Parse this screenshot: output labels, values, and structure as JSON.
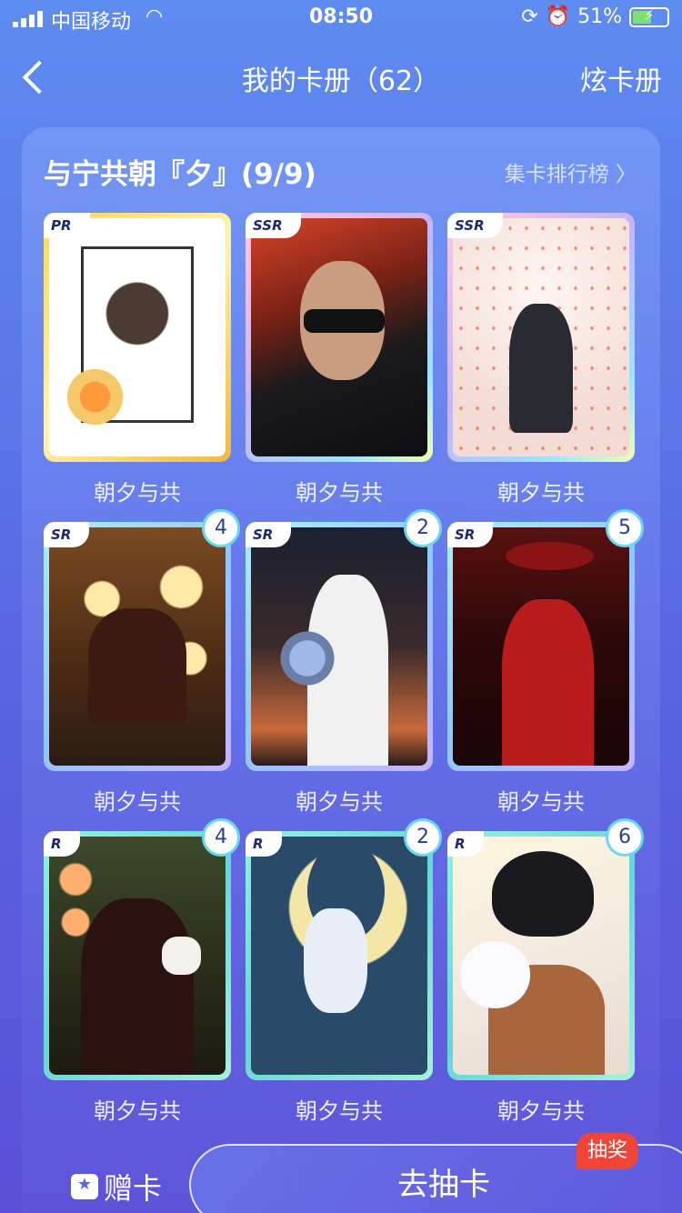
{
  "status_bar": {
    "carrier": "中国移动",
    "time": "08:50",
    "battery": "51%"
  },
  "nav": {
    "title": "我的卡册（62）",
    "right_action": "炫卡册"
  },
  "album": {
    "title": "与宁共朝『夕』(9/9)",
    "rank_link": "集卡排行榜 〉"
  },
  "cards": [
    {
      "rarity": "PR",
      "name": "朝夕与共",
      "count": ""
    },
    {
      "rarity": "SSR",
      "name": "朝夕与共",
      "count": ""
    },
    {
      "rarity": "SSR",
      "name": "朝夕与共",
      "count": ""
    },
    {
      "rarity": "SR",
      "name": "朝夕与共",
      "count": "4"
    },
    {
      "rarity": "SR",
      "name": "朝夕与共",
      "count": "2"
    },
    {
      "rarity": "SR",
      "name": "朝夕与共",
      "count": "5"
    },
    {
      "rarity": "R",
      "name": "朝夕与共",
      "count": "4"
    },
    {
      "rarity": "R",
      "name": "朝夕与共",
      "count": "2"
    },
    {
      "rarity": "R",
      "name": "朝夕与共",
      "count": "6"
    }
  ],
  "bottom": {
    "gift_label": "赠卡",
    "draw_label": "去抽卡",
    "lottery_badge": "抽奖"
  }
}
